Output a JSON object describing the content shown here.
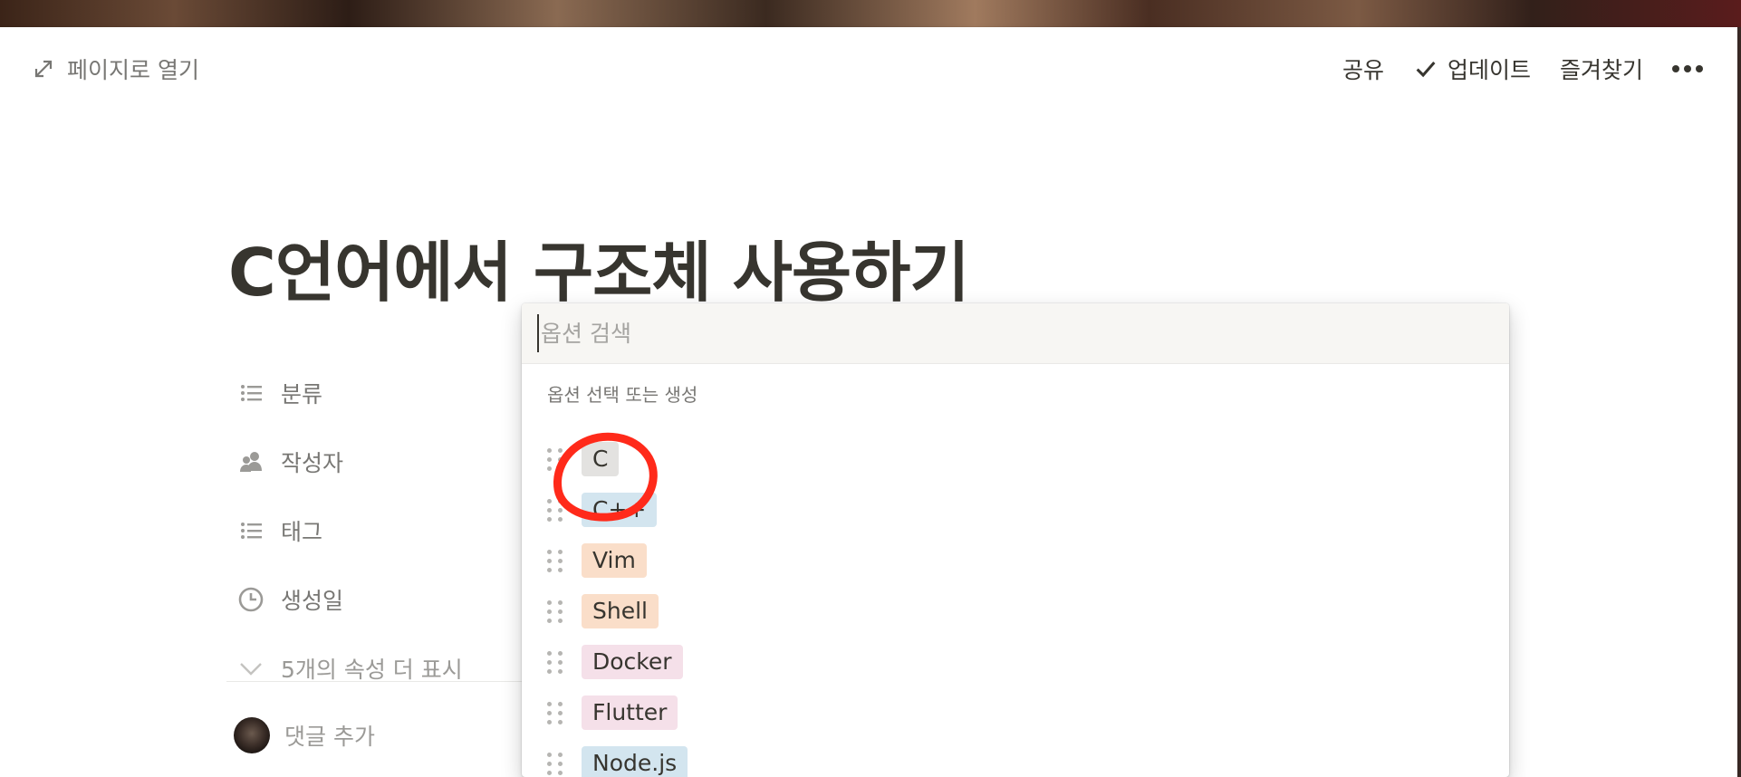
{
  "topbar": {
    "open_as_page": "페이지로 열기",
    "share": "공유",
    "updates": "업데이트",
    "favorite": "즐겨찾기"
  },
  "page": {
    "title": "C언어에서 구조체 사용하기"
  },
  "properties": [
    {
      "label": "분류",
      "icon": "list-icon"
    },
    {
      "label": "작성자",
      "icon": "people-icon"
    },
    {
      "label": "태그",
      "icon": "list-icon"
    },
    {
      "label": "생성일",
      "icon": "clock-icon"
    }
  ],
  "more_properties": "5개의 속성 더 표시",
  "comment": {
    "placeholder": "댓글 추가"
  },
  "popup": {
    "search_placeholder": "옵션 검색",
    "section_label": "옵션 선택 또는 생성",
    "options": [
      {
        "label": "C",
        "color": "#e3e2e0"
      },
      {
        "label": "C++",
        "color": "#d3e5ef"
      },
      {
        "label": "Vim",
        "color": "#fadec9"
      },
      {
        "label": "Shell",
        "color": "#fadec9"
      },
      {
        "label": "Docker",
        "color": "#f5e0e9"
      },
      {
        "label": "Flutter",
        "color": "#f5e0e9"
      },
      {
        "label": "Node.js",
        "color": "#d3e5ef"
      }
    ]
  },
  "annotation": {
    "color": "#ff2a1a"
  }
}
